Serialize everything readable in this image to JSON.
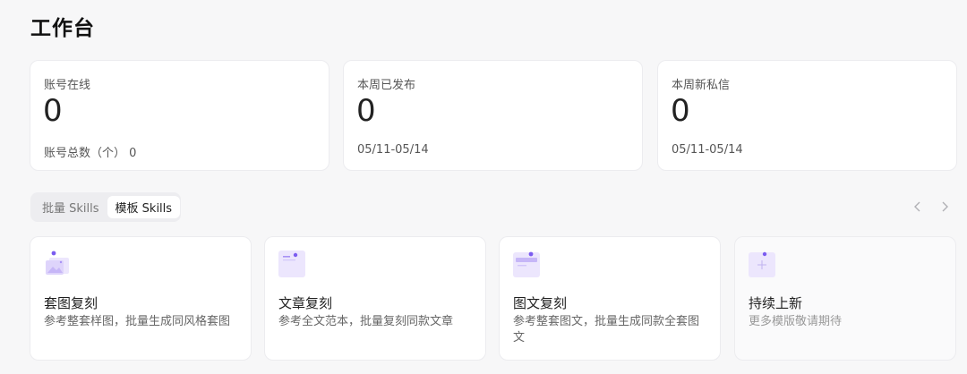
{
  "page": {
    "title": "工作台"
  },
  "stats": [
    {
      "label": "账号在线",
      "value": "0",
      "sub": "账号总数（个） 0"
    },
    {
      "label": "本周已发布",
      "value": "0",
      "sub": "05/11-05/14"
    },
    {
      "label": "本周新私信",
      "value": "0",
      "sub": "05/11-05/14"
    }
  ],
  "tabs": [
    {
      "label": "批量 Skills",
      "active": false
    },
    {
      "label": "模板 Skills",
      "active": true
    }
  ],
  "nav": {
    "prev_icon": "chevron-left-icon",
    "next_icon": "chevron-right-icon"
  },
  "skills": [
    {
      "title": "套图复刻",
      "desc": "参考整套样图，批量生成同风格套图",
      "icon": "image-stack-icon"
    },
    {
      "title": "文章复刻",
      "desc": "参考全文范本，批量复刻同款文章",
      "icon": "article-icon"
    },
    {
      "title": "图文复刻",
      "desc": "参考整套图文，批量生成同款全套图文",
      "icon": "image-text-icon"
    },
    {
      "title": "持续上新",
      "desc": "更多模版敬请期待",
      "icon": "plus-icon"
    }
  ],
  "colors": {
    "accent": "#7b5cf0",
    "accent_light": "#ece6fd"
  }
}
